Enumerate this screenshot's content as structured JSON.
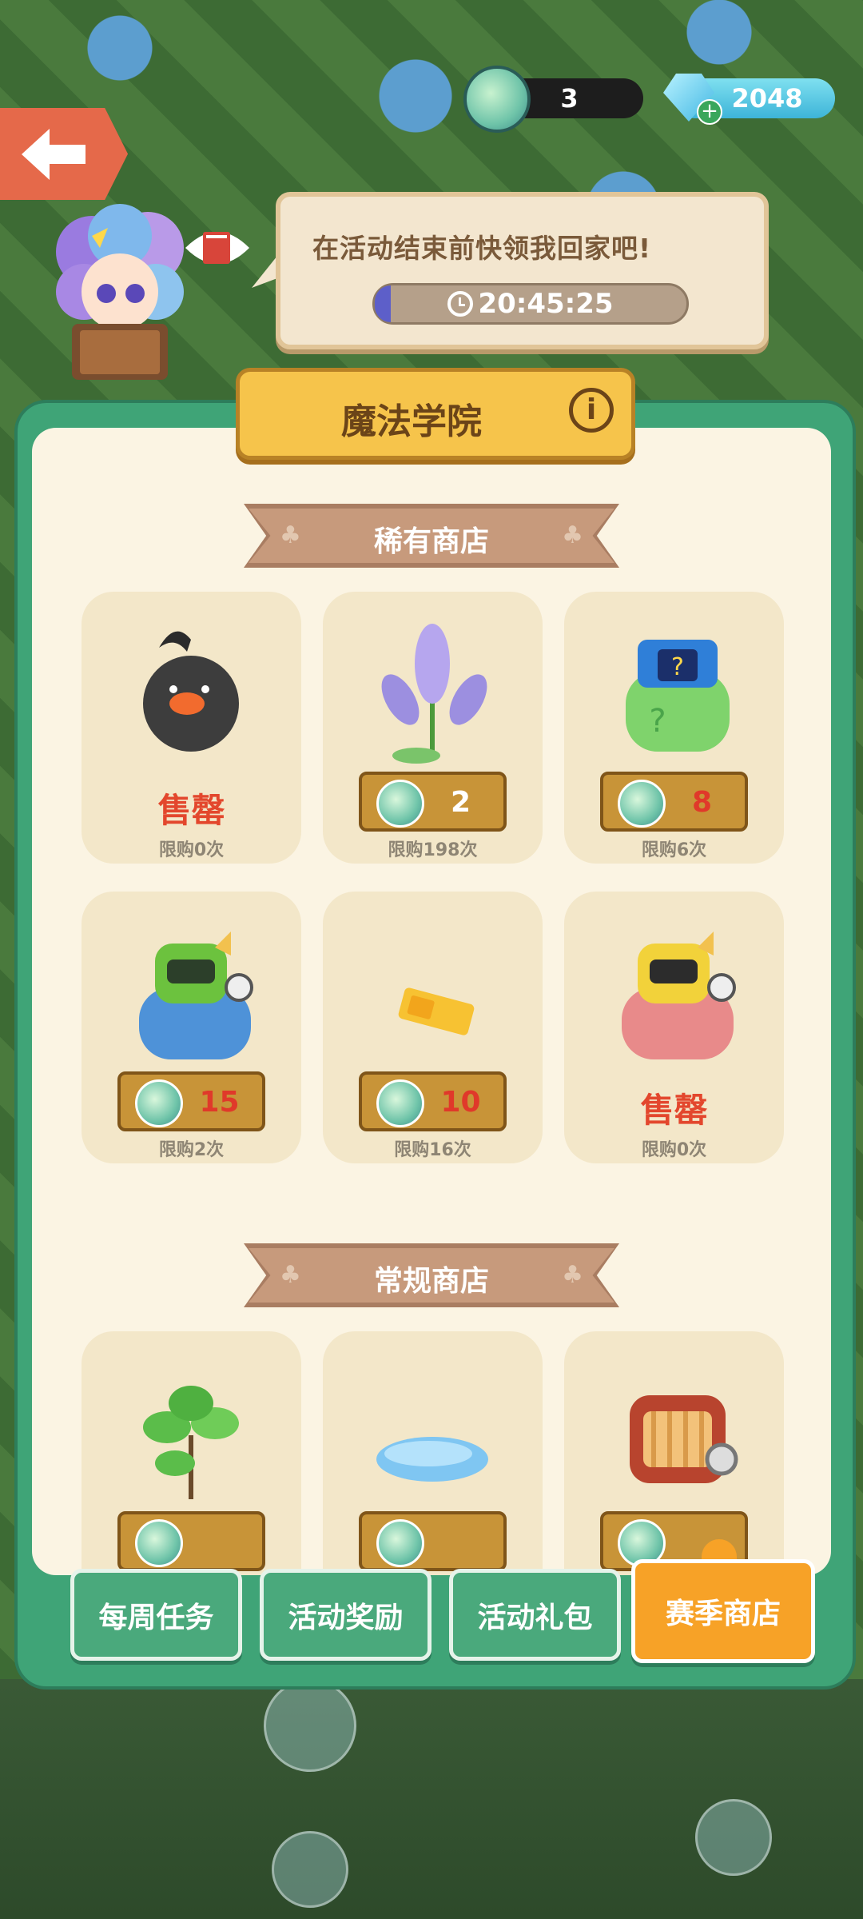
{
  "header": {
    "leaf_count": "3",
    "gem_count": "2048"
  },
  "event": {
    "speech": "在活动结束前快领我回家吧!",
    "timer": "20:45:25",
    "timer_progress": 0.05
  },
  "panel": {
    "title": "魔法学院"
  },
  "rare_shop": {
    "title": "稀有商店",
    "items": [
      {
        "price": "",
        "status": "售罄",
        "limit": "限购0次"
      },
      {
        "price": "2",
        "status": "",
        "limit": "限购198次"
      },
      {
        "price": "8",
        "status": "",
        "limit": "限购6次"
      },
      {
        "price": "15",
        "status": "",
        "limit": "限购2次"
      },
      {
        "price": "10",
        "status": "",
        "limit": "限购16次"
      },
      {
        "price": "",
        "status": "售罄",
        "limit": "限购0次"
      }
    ]
  },
  "regular_shop": {
    "title": "常规商店"
  },
  "tabs": {
    "weekly": "每周任务",
    "rewards": "活动奖励",
    "gifts": "活动礼包",
    "season_shop": "赛季商店"
  },
  "colors": {
    "panel_green": "#3fa477",
    "accent_orange": "#f7a227",
    "soldout_red": "#e3472d"
  }
}
